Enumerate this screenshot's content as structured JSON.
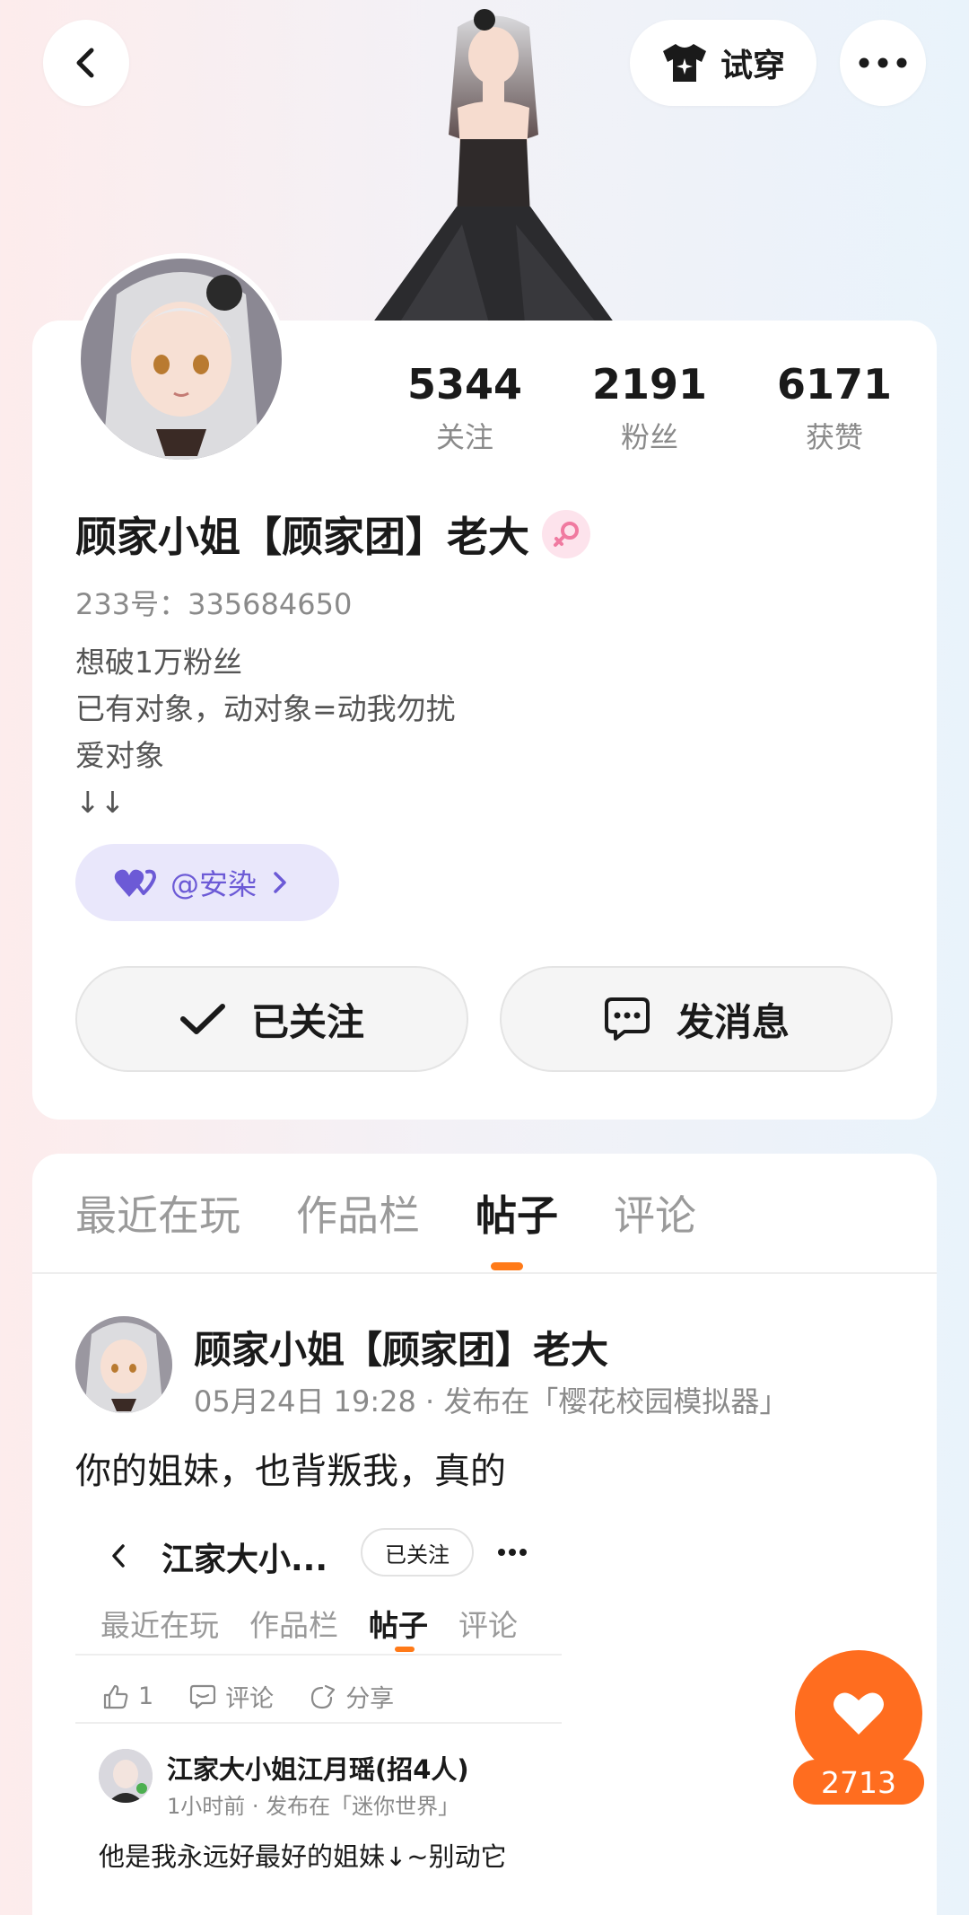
{
  "header": {
    "tryon_label": "试穿",
    "icons": [
      "back-arrow-icon",
      "shirt-sparkle-icon",
      "more-dots-icon"
    ]
  },
  "profile": {
    "stats": [
      {
        "value": "5344",
        "label": "关注"
      },
      {
        "value": "2191",
        "label": "粉丝"
      },
      {
        "value": "6171",
        "label": "获赞"
      }
    ],
    "username": "顾家小姐【顾家团】老大",
    "gender": "female",
    "uid": "233号：335684650",
    "bio": [
      "想破1万粉丝",
      "已有对象，动对象=动我勿扰",
      "爱对象",
      "↓↓"
    ],
    "partner": {
      "name": "@安染"
    },
    "follow_label": "已关注",
    "message_label": "发消息"
  },
  "tabs": [
    {
      "label": "最近在玩",
      "active": false
    },
    {
      "label": "作品栏",
      "active": false
    },
    {
      "label": "帖子",
      "active": true
    },
    {
      "label": "评论",
      "active": false
    }
  ],
  "post": {
    "author": "顾家小姐【顾家团】老大",
    "meta": "05月24日 19:28 · 发布在「樱花校园模拟器」",
    "text": "你的姐妹，也背叛我，真的",
    "screenshot": {
      "title": "江家大小...",
      "follow_label": "已关注",
      "tabs": [
        {
          "label": "最近在玩",
          "active": false
        },
        {
          "label": "作品栏",
          "active": false
        },
        {
          "label": "帖子",
          "active": true
        },
        {
          "label": "评论",
          "active": false
        }
      ],
      "like_count": "1",
      "comment_label": "评论",
      "share_label": "分享",
      "author": "江家大小姐江月瑶(招4人)",
      "meta": "1小时前 · 发布在「迷你世界」",
      "text": "他是我永远好最好的姐妹↓~别动它"
    }
  },
  "like_fab": {
    "count": "2713"
  },
  "colors": {
    "accent": "#ff6d1f",
    "partner": "#6c5ad6",
    "gender": "#f07aa0"
  }
}
